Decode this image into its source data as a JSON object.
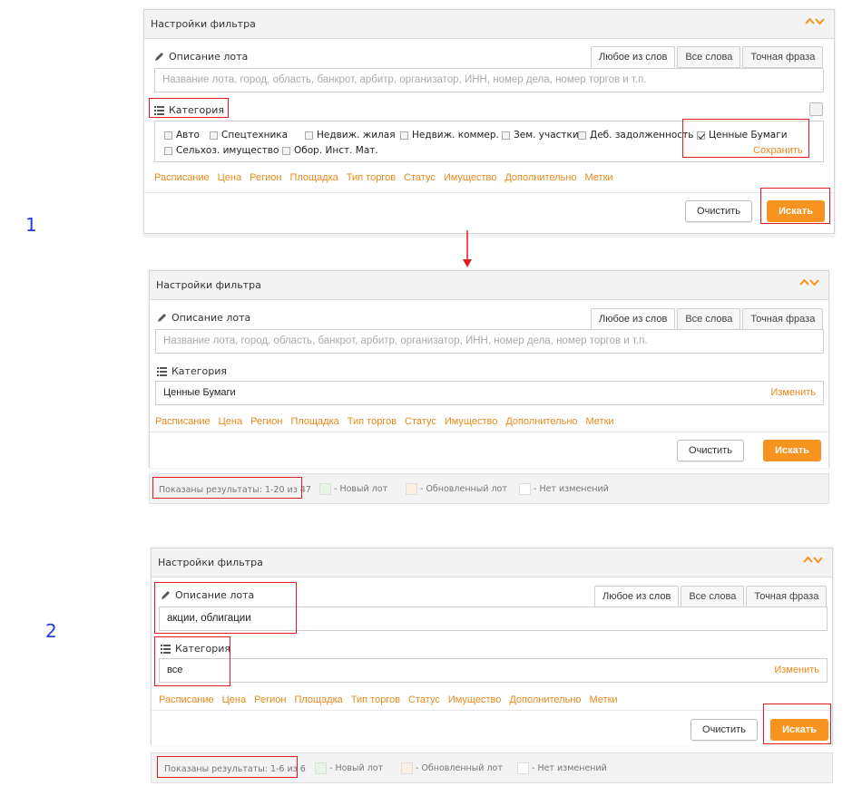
{
  "steps": {
    "one": "1",
    "two": "2"
  },
  "colors": {
    "accent": "#f7931e",
    "link": "#e9891c",
    "highlight": "#e01c1c",
    "step": "#1e3fd8",
    "new_lot": "#e6f5e6",
    "updated_lot": "#fbefe3",
    "unchanged": "#ffffff"
  },
  "filter": {
    "title": "Настройки фильтра",
    "description_label": "Описание лота",
    "tabs": [
      "Любое из слов",
      "Все слова",
      "Точная фраза"
    ],
    "description_placeholder": "Название лота, город, область, банкрот, арбитр, организатор, ИНН, номер дела, номер торгов и т.п.",
    "category_label": "Категория",
    "links": [
      "Расписание",
      "Цена",
      "Регион",
      "Площадка",
      "Тип торгов",
      "Статус",
      "Имущество",
      "Дополнительно",
      "Метки"
    ],
    "clear_label": "Очистить",
    "search_label": "Искать",
    "change_label": "Изменить",
    "save_label": "Сохранить"
  },
  "panel1": {
    "categories": [
      {
        "label": "Авто",
        "checked": false
      },
      {
        "label": "Спецтехника",
        "checked": false
      },
      {
        "label": "Недвиж. жилая",
        "checked": false
      },
      {
        "label": "Недвиж. коммер.",
        "checked": false
      },
      {
        "label": "Зем. участки",
        "checked": false
      },
      {
        "label": "Деб. задолженность",
        "checked": false
      },
      {
        "label": "Ценные Бумаги",
        "checked": true
      },
      {
        "label": "Сельхоз. имущество",
        "checked": false
      },
      {
        "label": "Обор. Инст. Мат.",
        "checked": false
      }
    ]
  },
  "panel2": {
    "category_value": "Ценные Бумаги",
    "results": "Показаны результаты: 1-20 из 47"
  },
  "panel3": {
    "description_value": "акции, облигации",
    "category_value": "все",
    "results": "Показаны результаты: 1-6 из 6"
  },
  "legend": {
    "new_lot": "- Новый лот",
    "updated_lot": "- Обновленный лот",
    "unchanged": "- Нет изменений"
  }
}
